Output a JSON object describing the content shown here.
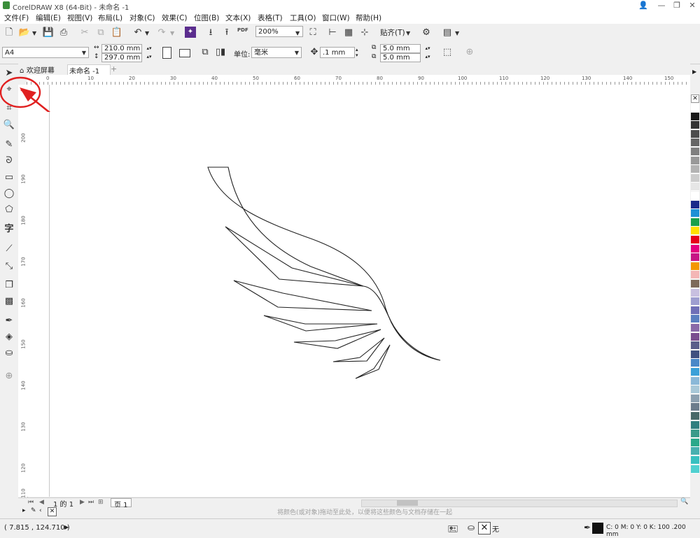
{
  "window": {
    "title": "CorelDRAW X8 (64-Bit) - 未命名 -1",
    "app_icon": "coreldraw-icon",
    "controls": {
      "minimize": "—",
      "restore": "❐",
      "close": "✕",
      "user": "👤"
    }
  },
  "menu": {
    "items": [
      "文件(F)",
      "编辑(E)",
      "视图(V)",
      "布局(L)",
      "对象(C)",
      "效果(C)",
      "位图(B)",
      "文本(X)",
      "表格(T)",
      "工具(O)",
      "窗口(W)",
      "帮助(H)"
    ]
  },
  "toolbar": {
    "zoom_value": "200%",
    "snap_label": "贴齐(T)",
    "pdf_label": "PDF"
  },
  "propertybar": {
    "page_size": "A4",
    "width": "210.0 mm",
    "height": "297.0 mm",
    "units_label": "单位:",
    "units_value": "毫米",
    "nudge": ".1 mm",
    "dup_x": "5.0 mm",
    "dup_y": "5.0 mm"
  },
  "tabs": {
    "welcome": "欢迎屏幕",
    "document": "未命名 -1",
    "add": "+"
  },
  "ruler": {
    "h_ticks": [
      "0",
      "10",
      "20",
      "30",
      "40",
      "50",
      "60",
      "70",
      "80",
      "90",
      "100",
      "110",
      "120",
      "130",
      "140",
      "150"
    ],
    "v_ticks": [
      "200",
      "190",
      "180",
      "170",
      "160",
      "150",
      "140",
      "130",
      "120",
      "110"
    ]
  },
  "page_nav": {
    "counter": "1 的 1",
    "page_tab": "页 1"
  },
  "hint": "将颜色(或对象)拖动至此处，以便将这些颜色与文档存储在一起",
  "status": {
    "coords": "( 7.815 , 124.710 )",
    "fill_label": "无",
    "outline_info": "C: 0 M: 0 Y: 0 K: 100  .200 mm"
  },
  "palette_colors": [
    "#ffffff",
    "#1a1a1a",
    "#333333",
    "#4d4d4d",
    "#666666",
    "#808080",
    "#999999",
    "#b3b3b3",
    "#cccccc",
    "#e6e6e6",
    "#ffffff",
    "#1b2a8a",
    "#1e90d6",
    "#18a04b",
    "#ffe000",
    "#e6001a",
    "#e4007f",
    "#c71585",
    "#f39800",
    "#f4b6b6",
    "#7d6a5a",
    "#c8c0e0",
    "#9e9ed0",
    "#6f6fb7",
    "#5a7fc0",
    "#8a6aa8",
    "#7a4e8f",
    "#5a5e8a",
    "#405080",
    "#4a88c8",
    "#3aa0d8",
    "#8ab8d8",
    "#a8c8d8",
    "#8ca0b0",
    "#6c7c8c",
    "#486868",
    "#2f7f7f",
    "#3a9a8a",
    "#2aa88a",
    "#48b0b0",
    "#38c0c0",
    "#50d0d0"
  ],
  "annotation": {
    "circle_color": "#e02020",
    "arrow_color": "#e02020"
  }
}
